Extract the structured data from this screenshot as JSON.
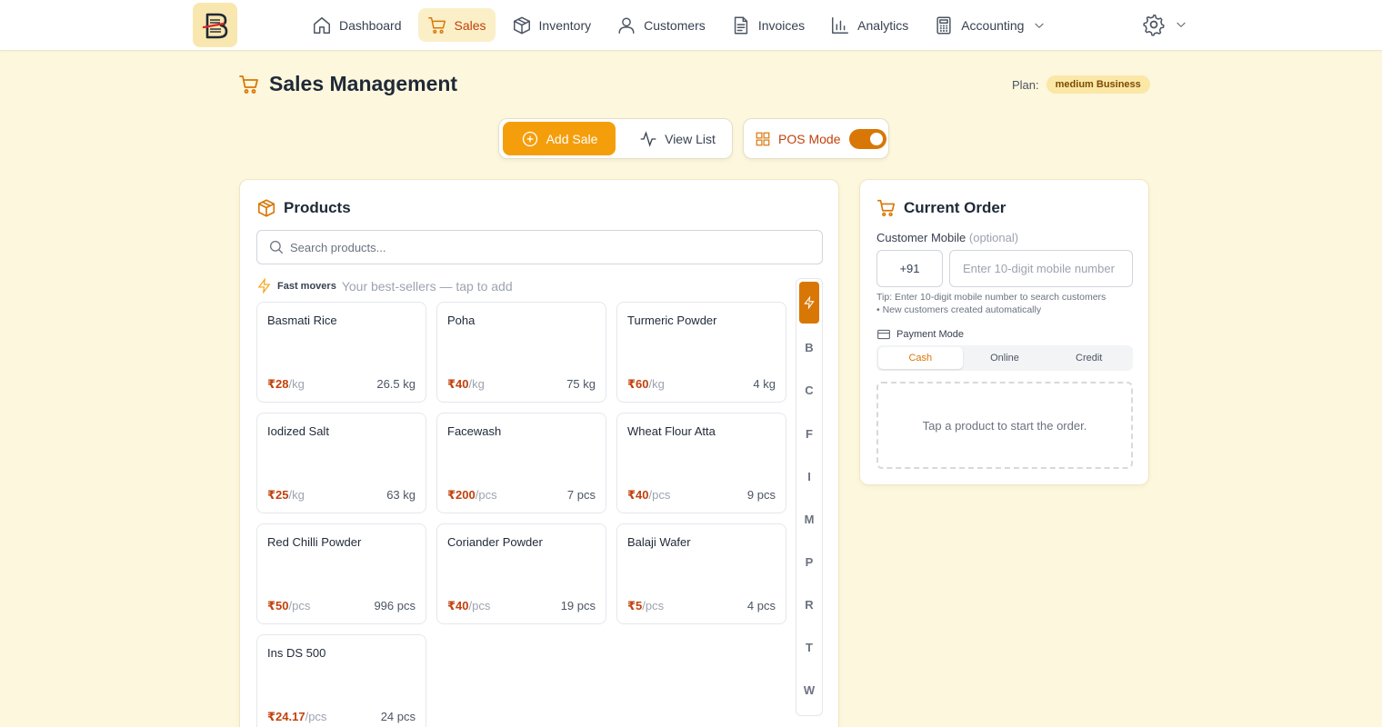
{
  "nav": {
    "items": [
      {
        "label": "Dashboard",
        "icon": "home-icon"
      },
      {
        "label": "Sales",
        "icon": "cart-icon",
        "active": true
      },
      {
        "label": "Inventory",
        "icon": "box-icon"
      },
      {
        "label": "Customers",
        "icon": "user-icon"
      },
      {
        "label": "Invoices",
        "icon": "document-icon"
      },
      {
        "label": "Analytics",
        "icon": "bar-chart-icon"
      },
      {
        "label": "Accounting",
        "icon": "calculator-icon"
      }
    ]
  },
  "header": {
    "title": "Sales Management",
    "plan_label": "Plan:",
    "plan_value": "medium Business"
  },
  "modes": {
    "add_sale": "Add Sale",
    "view_list": "View List",
    "pos_mode": "POS Mode",
    "pos_enabled": true
  },
  "products": {
    "title": "Products",
    "search_placeholder": "Search products...",
    "fast_title": "Fast movers",
    "fast_subtitle": "Your best-sellers — tap to add",
    "items": [
      {
        "name": "Basmati Rice",
        "price": "₹28",
        "unit": "/kg",
        "stock": "26.5 kg"
      },
      {
        "name": "Poha",
        "price": "₹40",
        "unit": "/kg",
        "stock": "75 kg"
      },
      {
        "name": "Turmeric Powder",
        "price": "₹60",
        "unit": "/kg",
        "stock": "4 kg"
      },
      {
        "name": "Iodized Salt",
        "price": "₹25",
        "unit": "/kg",
        "stock": "63 kg"
      },
      {
        "name": "Facewash",
        "price": "₹200",
        "unit": "/pcs",
        "stock": "7 pcs"
      },
      {
        "name": "Wheat Flour Atta",
        "price": "₹40",
        "unit": "/pcs",
        "stock": "9 pcs"
      },
      {
        "name": "Red Chilli Powder",
        "price": "₹50",
        "unit": "/pcs",
        "stock": "996 pcs"
      },
      {
        "name": "Coriander Powder",
        "price": "₹40",
        "unit": "/pcs",
        "stock": "19 pcs"
      },
      {
        "name": "Balaji Wafer",
        "price": "₹5",
        "unit": "/pcs",
        "stock": "4 pcs"
      },
      {
        "name": "Ins DS 500",
        "price": "₹24.17",
        "unit": "/pcs",
        "stock": "24 pcs"
      }
    ],
    "alpha_index": [
      "B",
      "C",
      "F",
      "I",
      "M",
      "P",
      "R",
      "T",
      "W"
    ]
  },
  "order": {
    "title": "Current Order",
    "mobile_label": "Customer Mobile",
    "mobile_optional": "(optional)",
    "country_code": "+91",
    "mobile_placeholder": "Enter 10-digit mobile number",
    "tip_line1": "Tip: Enter 10-digit mobile number to search customers",
    "tip_line2": "• New customers created automatically",
    "payment_label": "Payment Mode",
    "payment_options": [
      "Cash",
      "Online",
      "Credit"
    ],
    "payment_selected": "Cash",
    "empty_text": "Tap a product to start the order."
  },
  "colors": {
    "background": "#fdf7dd",
    "accent": "#f59e0b",
    "accent_dark": "#d97706",
    "price": "#c2410c"
  }
}
